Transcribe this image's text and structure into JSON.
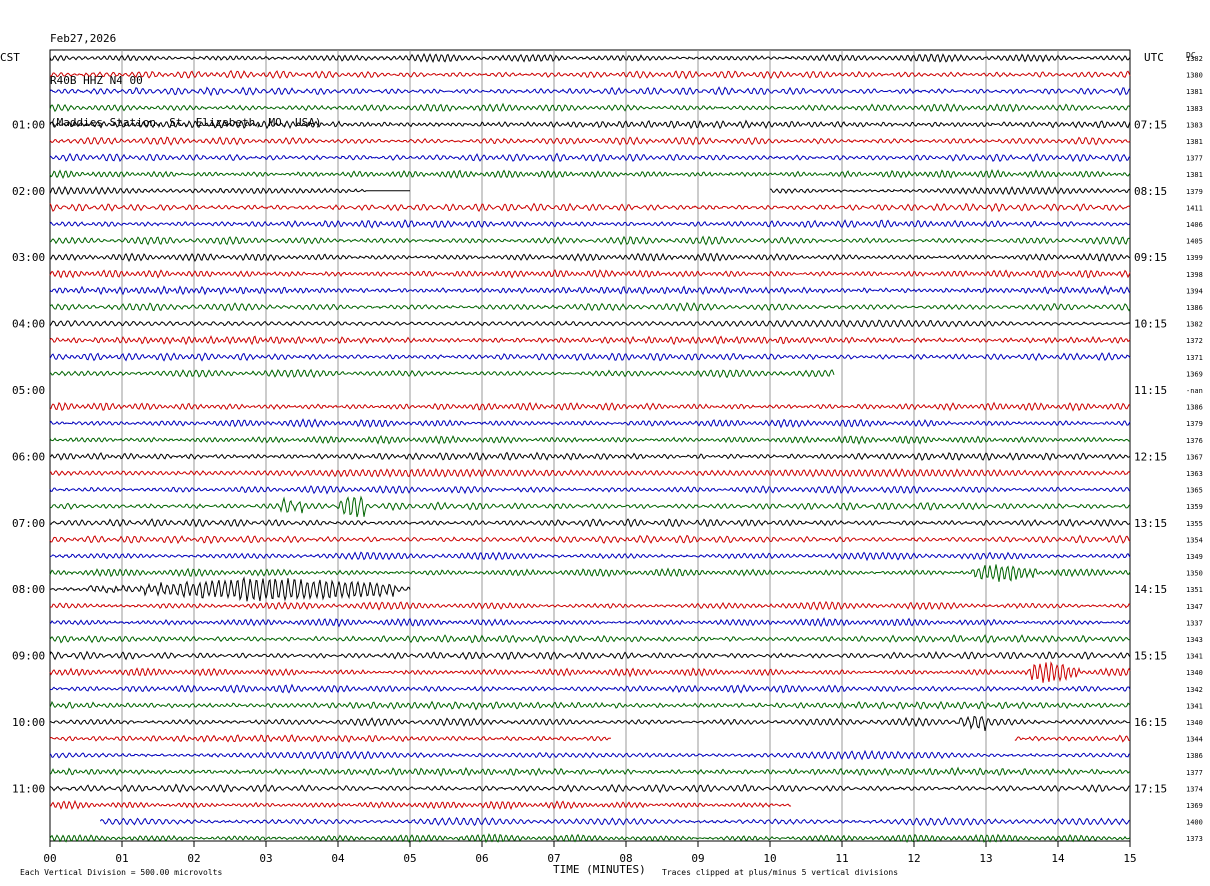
{
  "header": {
    "date": "Feb27,2026",
    "channel": "R40B HHZ N4 00",
    "station": "(Maddies Station, St. Elizabeth, MO, USA)"
  },
  "left_tz": "CST",
  "right_tz": "UTC",
  "right_col_header": "DC",
  "footer": {
    "scale": "Each Vertical Division =  500.00 microvolts",
    "xlabel": "TIME (MINUTES)",
    "clip_note": "Traces clipped at plus/minus 5 vertical divisions"
  },
  "colors": {
    "black": "#000000",
    "red": "#cc0000",
    "blue": "#0000bb",
    "green": "#006400",
    "grid": "#999999"
  },
  "chart_data": {
    "type": "line",
    "title": "R40B HHZ N4 00",
    "xlabel": "TIME (MINUTES)",
    "x_ticks": [
      "00",
      "01",
      "02",
      "03",
      "04",
      "05",
      "06",
      "07",
      "08",
      "09",
      "10",
      "11",
      "12",
      "13",
      "14",
      "15"
    ],
    "xlim": [
      0,
      15
    ],
    "rows_per_hour": 4,
    "minutes_per_row": 15,
    "color_cycle": [
      "black",
      "red",
      "blue",
      "green"
    ],
    "left_hour_labels": [
      "01:00",
      "02:00",
      "03:00",
      "04:00",
      "05:00",
      "06:00",
      "07:00",
      "08:00",
      "09:00",
      "10:00",
      "11:00"
    ],
    "right_hour_labels": [
      "07:15",
      "08:15",
      "09:15",
      "10:15",
      "11:15",
      "12:15",
      "13:15",
      "14:15",
      "15:15",
      "16:15",
      "17:15"
    ],
    "dc_offsets": [
      "1382",
      "1380",
      "1381",
      "1383",
      "1383",
      "1381",
      "1377",
      "1381",
      "1379",
      "1411",
      "1406",
      "1405",
      "1399",
      "1398",
      "1394",
      "1386",
      "1382",
      "1372",
      "1371",
      "1369",
      "-nan",
      "1386",
      "1379",
      "1376",
      "1367",
      "1363",
      "1365",
      "1359",
      "1355",
      "1354",
      "1349",
      "1350",
      "1351",
      "1347",
      "1337",
      "1343",
      "1341",
      "1340",
      "1342",
      "1341",
      "1340",
      "1344",
      "1386",
      "1377",
      "1374",
      "1369",
      "1400",
      "1373"
    ],
    "data_segments": [
      [
        [
          0,
          15
        ]
      ],
      [
        [
          0,
          15
        ]
      ],
      [
        [
          0,
          15
        ]
      ],
      [
        [
          0,
          15
        ]
      ],
      [
        [
          0,
          15
        ]
      ],
      [
        [
          0,
          15
        ]
      ],
      [
        [
          0,
          15
        ]
      ],
      [
        [
          0,
          15
        ]
      ],
      [
        [
          0,
          5
        ],
        [
          10,
          15
        ]
      ],
      [
        [
          0,
          15
        ]
      ],
      [
        [
          0,
          15
        ]
      ],
      [
        [
          0,
          15
        ]
      ],
      [
        [
          0,
          15
        ]
      ],
      [
        [
          0,
          15
        ]
      ],
      [
        [
          0,
          15
        ]
      ],
      [
        [
          0,
          15
        ]
      ],
      [
        [
          0,
          15
        ]
      ],
      [
        [
          0,
          15
        ]
      ],
      [
        [
          0,
          15
        ]
      ],
      [
        [
          0,
          10.9
        ]
      ],
      [],
      [
        [
          0,
          15
        ]
      ],
      [
        [
          0,
          15
        ]
      ],
      [
        [
          0,
          15
        ]
      ],
      [
        [
          0,
          15
        ]
      ],
      [
        [
          0,
          15
        ]
      ],
      [
        [
          0,
          15
        ]
      ],
      [
        [
          0,
          15
        ]
      ],
      [
        [
          0,
          15
        ]
      ],
      [
        [
          0,
          15
        ]
      ],
      [
        [
          0,
          15
        ]
      ],
      [
        [
          0,
          15
        ]
      ],
      [
        [
          0,
          5
        ]
      ],
      [
        [
          0,
          15
        ]
      ],
      [
        [
          0,
          15
        ]
      ],
      [
        [
          0,
          15
        ]
      ],
      [
        [
          0,
          15
        ]
      ],
      [
        [
          0,
          15
        ]
      ],
      [
        [
          0,
          15
        ]
      ],
      [
        [
          0,
          15
        ]
      ],
      [
        [
          0,
          15
        ]
      ],
      [
        [
          0,
          7.8
        ],
        [
          13.4,
          15
        ]
      ],
      [
        [
          0,
          15
        ]
      ],
      [
        [
          0,
          15
        ]
      ],
      [
        [
          0,
          15
        ]
      ],
      [
        [
          0,
          10.3
        ]
      ],
      [
        [
          0.7,
          15
        ]
      ],
      [
        [
          0,
          15
        ]
      ]
    ],
    "events": [
      {
        "row": 8,
        "t_start": 4.4,
        "t_end": 5.0,
        "type": "flat"
      },
      {
        "row": 27,
        "t_start": 3.2,
        "t_end": 3.5,
        "type": "spike"
      },
      {
        "row": 27,
        "t_start": 4.0,
        "t_end": 4.4,
        "type": "burst"
      },
      {
        "row": 31,
        "t_start": 12.8,
        "t_end": 13.7,
        "type": "burst"
      },
      {
        "row": 32,
        "t_start": 0.5,
        "t_end": 4.8,
        "type": "burst"
      },
      {
        "row": 37,
        "t_start": 13.6,
        "t_end": 14.3,
        "type": "burst"
      },
      {
        "row": 40,
        "t_start": 12.6,
        "t_end": 13.0,
        "type": "burst"
      }
    ]
  }
}
